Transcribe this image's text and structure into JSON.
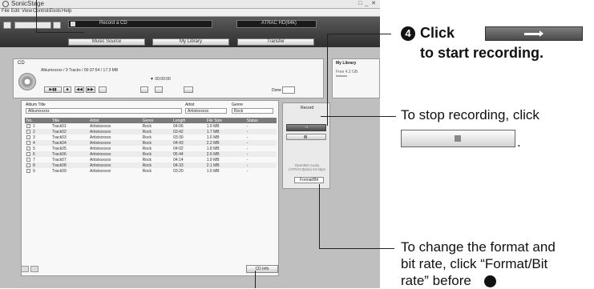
{
  "app": {
    "title": "SonicStage",
    "window_controls": "□ _ ✕",
    "menu": [
      "File",
      "Edit",
      "View",
      "Controls",
      "Tools",
      "Help"
    ],
    "record_bar_label": "Record a CD",
    "format_bar_label": "ATRAC HD(64k)",
    "nav_tabs": [
      "Music Source",
      "My Library",
      "Transfer"
    ]
  },
  "cd": {
    "label": "CD",
    "info": "Albumxxxxx   /   9 Tracks  /  00:37:54  /  17.3 MB",
    "time": "▼  00:00:00",
    "done_label": "Done"
  },
  "library": {
    "title": "My Library",
    "free": "Free 4.2 GB"
  },
  "form": {
    "album_title_label": "Album Title",
    "album_title_value": "Albumxxxxx",
    "artist_label": "Artist",
    "artist_value": "Artistxxxxxx",
    "genre_label": "Genre",
    "genre_value": "Rock"
  },
  "table": {
    "columns": [
      "No.",
      "Title",
      "Artist",
      "Genre",
      "Length",
      "File Size",
      "Status"
    ],
    "rows": [
      [
        "1",
        "Track01",
        "Artistxxxxxx",
        "Rock",
        "04:06",
        "1.9 MB",
        "-"
      ],
      [
        "2",
        "Track02",
        "Artistxxxxxx",
        "Rock",
        "03:42",
        "1.7 MB",
        "-"
      ],
      [
        "3",
        "Track03",
        "Artistxxxxxx",
        "Rock",
        "03:30",
        "1.6 MB",
        "-"
      ],
      [
        "4",
        "Track04",
        "Artistxxxxxx",
        "Rock",
        "04:43",
        "2.2 MB",
        "-"
      ],
      [
        "5",
        "Track05",
        "Artistxxxxxx",
        "Rock",
        "04:02",
        "1.8 MB",
        "-"
      ],
      [
        "6",
        "Track06",
        "Artistxxxxxx",
        "Rock",
        "05:44",
        "2.6 MB",
        "-"
      ],
      [
        "7",
        "Track07",
        "Artistxxxxxx",
        "Rock",
        "04:14",
        "1.9 MB",
        "-"
      ],
      [
        "8",
        "Track08",
        "Artistxxxxxx",
        "Rock",
        "04:33",
        "2.1 MB",
        "-"
      ],
      [
        "9",
        "Track09",
        "Artistxxxxxx",
        "Rock",
        "03:20",
        "1.5 MB",
        "-"
      ]
    ]
  },
  "record_panel": {
    "label": "Record",
    "start_glyph": "→",
    "format_text": "OpenMG Audio (ATRAC3plus) 64 kbps",
    "format_button": "Format/Bit",
    "cd_info_button": "CD Info"
  },
  "annotations": {
    "step_number": "4",
    "step_click": "Click",
    "step_line2": "to start recording.",
    "stop_text": "To stop recording, click",
    "stop_period": ".",
    "format_line1": "To change the format and",
    "format_line2": "bit rate, click “Format/Bit",
    "format_line3": "rate” before"
  }
}
